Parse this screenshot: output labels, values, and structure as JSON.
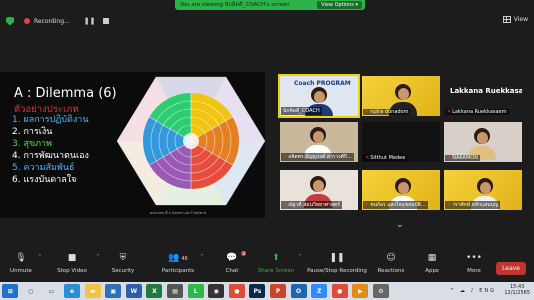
{
  "banner": {
    "text": "You are viewing นักคิดดี_COACH's screen",
    "view_options": "View Options ▾"
  },
  "topbar": {
    "recording": "Recording...",
    "view": "View"
  },
  "slide": {
    "title": "A : Dilemma (6)",
    "subtitle": "ตัวอย่างประเภท",
    "items": [
      {
        "text": "1.  ผลการปฏิบัติงาน",
        "color": "#3fb8ff"
      },
      {
        "text": "2.  การเงิน",
        "color": "#ffffff"
      },
      {
        "text": "3.  สุขภาพ",
        "color": "#3fe03f"
      },
      {
        "text": "4.  การพัฒนาตนเอง",
        "color": "#ffffff"
      },
      {
        "text": "5.  ความสัมพันธ์",
        "color": "#3fb8ff"
      },
      {
        "text": "6.  แรงบันดาลใจ",
        "color": "#ffffff"
      }
    ],
    "credit": "pictures ที่ a Game Lab Thailand"
  },
  "videos": [
    {
      "name": "นักคิดดี_COACH",
      "muted": false,
      "overlay": "Coach PROGRAM"
    },
    {
      "name": "rujira donadom",
      "muted": true
    },
    {
      "name": "Lakkana Ruekkasaem",
      "muted": true,
      "big": "Lakkana Ruekkasa..."
    },
    {
      "name": "ลลิตพร ธัญญวงค์ สารวงศ์กี...",
      "muted": true
    },
    {
      "name": "Sitthut Medee",
      "muted": true
    },
    {
      "name": "NAKAMON",
      "muted": true
    },
    {
      "name": "ณัฐวดี สมนวิทยาศาสตร์",
      "muted": true
    },
    {
      "name": "ชนก์อร แสงใจมุขสมบัติ...",
      "muted": true
    },
    {
      "name": "วราศักษ์ หลักแสนบุญ",
      "muted": true
    }
  ],
  "toolbar": {
    "unmute": "Unmute",
    "stop_video": "Stop Video",
    "security": "Security",
    "participants": "Participants",
    "participants_count": "46",
    "chat": "Chat",
    "chat_badge": "3",
    "share": "Share Screen",
    "record": "Pause/Stop Recording",
    "reactions": "Reactions",
    "apps": "Apps",
    "more": "More",
    "leave": "Leave"
  },
  "taskbar": {
    "time": "15:43",
    "date": "12/1/2565",
    "lang": "ENG",
    "apps": [
      "search-icon",
      "task-view-icon",
      "edge-icon",
      "explorer-icon",
      "store-icon",
      "word-icon",
      "excel-icon",
      "calculator-icon",
      "line-icon",
      "camera-icon",
      "chrome-icon",
      "photoshop-icon",
      "powerpoint-icon",
      "outlook-icon",
      "zoom-icon",
      "chrome2-icon",
      "media-icon",
      "settings-icon"
    ]
  },
  "colors": {
    "accent": "#2db24a",
    "leave": "#c0352e",
    "active_speaker": "#f3d000"
  }
}
